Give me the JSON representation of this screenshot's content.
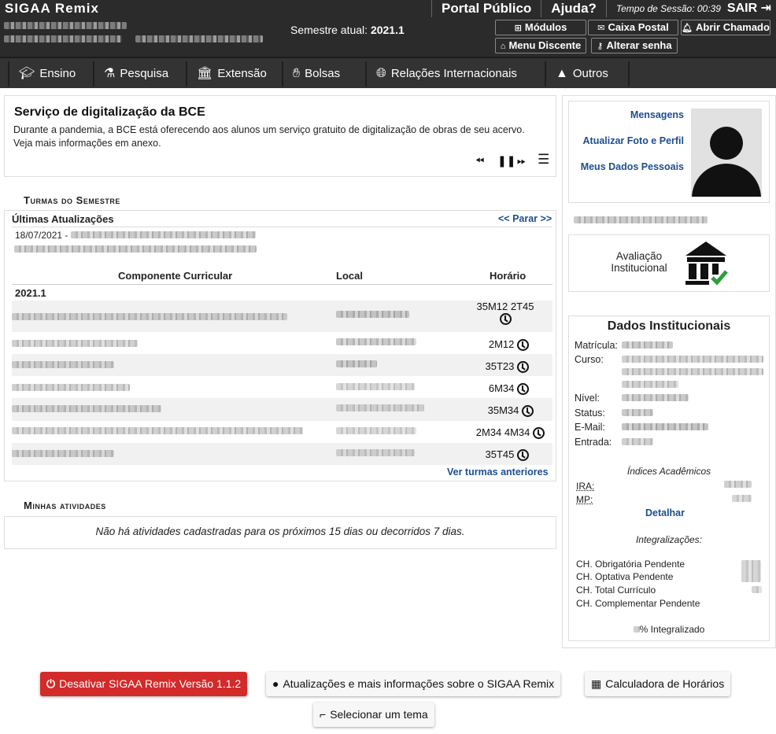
{
  "header": {
    "brand": "SIGAA Remix",
    "semester_label": "Semestre atual:",
    "semester_value": "2021.1",
    "portal_publico": "Portal Público",
    "ajuda": "Ajuda?",
    "sessao_label": "Tempo de Sessão:",
    "sessao_value": "00:39",
    "sair": "SAIR",
    "buttons": {
      "modulos": "Módulos",
      "caixa_postal": "Caixa Postal",
      "abrir_chamado": "Abrir Chamado",
      "menu_discente": "Menu Discente",
      "alterar_senha": "Alterar senha"
    }
  },
  "menu": [
    {
      "label": "Ensino",
      "icon": "graduation-cap-icon"
    },
    {
      "label": "Pesquisa",
      "icon": "flask-icon"
    },
    {
      "label": "Extensão",
      "icon": "building-plus-icon"
    },
    {
      "label": "Bolsas",
      "icon": "hand-money-icon"
    },
    {
      "label": "Relações Internacionais",
      "icon": "globe-icon"
    },
    {
      "label": "Outros",
      "icon": "shapes-icon"
    }
  ],
  "announcement": {
    "title": "Serviço de digitalização da BCE",
    "line1": "Durante a pandemia, a BCE está oferecendo aos alunos um serviço gratuito de digitalização de obras de seu acervo.",
    "line2": "Veja mais informações em anexo."
  },
  "turmas": {
    "section_title": "Turmas do Semestre",
    "updates_title": "Últimas Atualizações",
    "parar": "<< Parar >>",
    "update_date": "18/07/2021 -",
    "columns": {
      "componente": "Componente Curricular",
      "local": "Local",
      "horario": "Horário"
    },
    "group": "2021.1",
    "rows": [
      {
        "horario": "35M12 2T45"
      },
      {
        "horario": "2M12"
      },
      {
        "horario": "35T23"
      },
      {
        "horario": "6M34"
      },
      {
        "horario": "35M34"
      },
      {
        "horario": "2M34 4M34"
      },
      {
        "horario": "35T45"
      }
    ],
    "ver_anteriores": "Ver turmas anteriores"
  },
  "atividades": {
    "section_title": "Minhas atividades",
    "empty_text": "Não há atividades cadastradas para os próximos 15 dias ou decorridos 7 dias."
  },
  "profile": {
    "mensagens": "Mensagens",
    "atualizar_foto": "Atualizar Foto e Perfil",
    "meus_dados": "Meus Dados Pessoais"
  },
  "avaliacao": {
    "line1": "Avaliação",
    "line2": "Institucional"
  },
  "dados": {
    "title": "Dados Institucionais",
    "matricula": "Matrícula:",
    "curso": "Curso:",
    "nivel": "Nível:",
    "status": "Status:",
    "email": "E-Mail:",
    "entrada": "Entrada:",
    "indices_title": "Índices Acadêmicos",
    "ira": "IRA:",
    "mp": "MP:",
    "detalhar": "Detalhar",
    "integralizacoes_title": "Integralizações:",
    "ch_obrigatoria": "CH. Obrigatória Pendente",
    "ch_optativa": "CH. Optativa Pendente",
    "ch_total": "CH. Total Currículo",
    "ch_complementar": "CH. Complementar Pendente",
    "integralizado": "% Integralizado"
  },
  "footer": {
    "desativar": "Desativar SIGAA Remix Versão 1.1.2",
    "atualizacoes": "Atualizações e mais informações sobre o SIGAA Remix",
    "calculadora": "Calculadora de Horários",
    "tema": "Selecionar um tema"
  },
  "colors": {
    "link": "#1c4e8f",
    "topbar": "#2b2b2b",
    "danger": "#d32a2a",
    "check": "#2e9e3e"
  }
}
